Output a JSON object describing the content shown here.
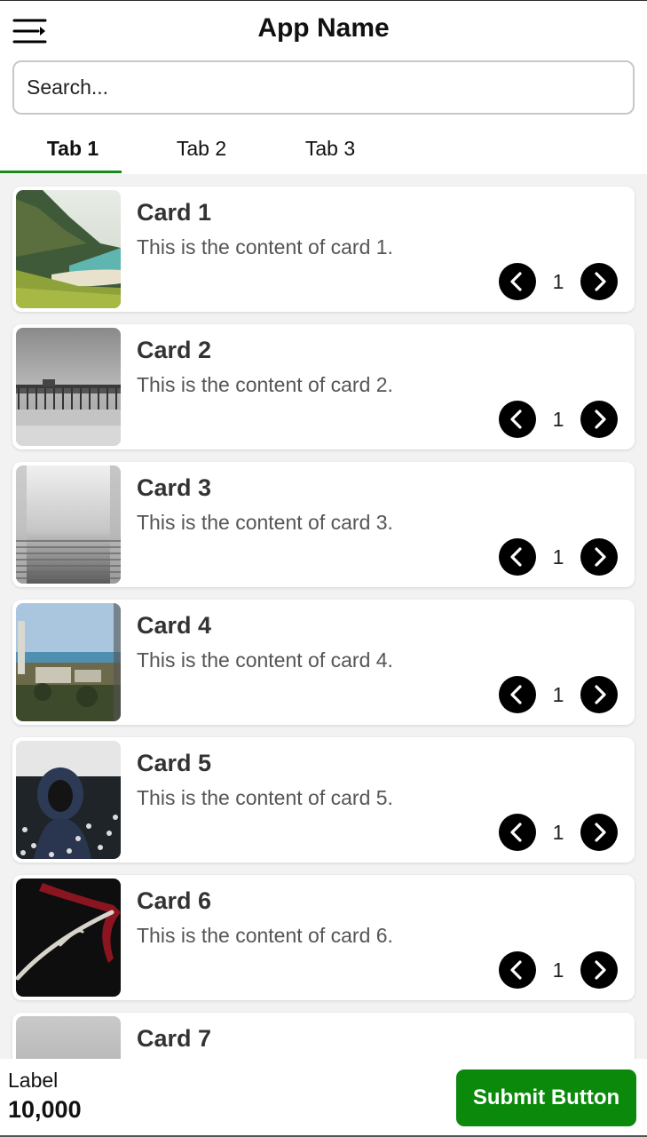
{
  "header": {
    "title": "App Name",
    "menu_icon": "menu-icon"
  },
  "search": {
    "placeholder": "Search..."
  },
  "tabs": [
    {
      "label": "Tab 1",
      "active": true
    },
    {
      "label": "Tab 2",
      "active": false
    },
    {
      "label": "Tab 3",
      "active": false
    }
  ],
  "accent_color": "#198a19",
  "cards": [
    {
      "title": "Card 1",
      "content": "This is the content of card 1.",
      "count": "1"
    },
    {
      "title": "Card 2",
      "content": "This is the content of card 2.",
      "count": "1"
    },
    {
      "title": "Card 3",
      "content": "This is the content of card 3.",
      "count": "1"
    },
    {
      "title": "Card 4",
      "content": "This is the content of card 4.",
      "count": "1"
    },
    {
      "title": "Card 5",
      "content": "This is the content of card 5.",
      "count": "1"
    },
    {
      "title": "Card 6",
      "content": "This is the content of card 6.",
      "count": "1"
    },
    {
      "title": "Card 7"
    }
  ],
  "footer": {
    "label": "Label",
    "value": "10,000",
    "submit_label": "Submit Button",
    "submit_color": "#0b890b"
  }
}
